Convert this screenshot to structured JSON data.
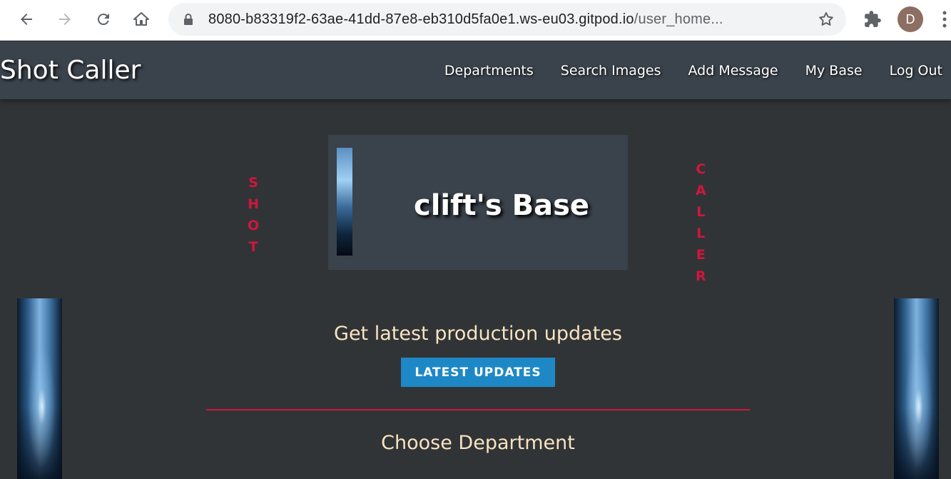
{
  "browser": {
    "url_main": "8080-b83319f2-63ae-41dd-87e8-eb310d5fa0e1.ws-eu03.gitpod.io",
    "url_rest": "/user_home...",
    "avatar_letter": "D"
  },
  "appbar": {
    "brand": "Shot Caller",
    "links": [
      "Departments",
      "Search Images",
      "Add Message",
      "My Base",
      "Log Out"
    ]
  },
  "banner": {
    "left_letters": [
      "S",
      "H",
      "O",
      "T"
    ],
    "right_letters": [
      "C",
      "A",
      "L",
      "L",
      "E",
      "R"
    ],
    "title": "clift's Base"
  },
  "main": {
    "updates_heading": "Get latest production updates",
    "updates_button": "LATEST UPDATES",
    "department_heading": "Choose Department"
  },
  "colors": {
    "accent_red": "#d2163c",
    "button_blue": "#1e88c7",
    "heading_cream": "#f8e3c2",
    "background": "#313436",
    "nav_bg": "#3a424b"
  }
}
